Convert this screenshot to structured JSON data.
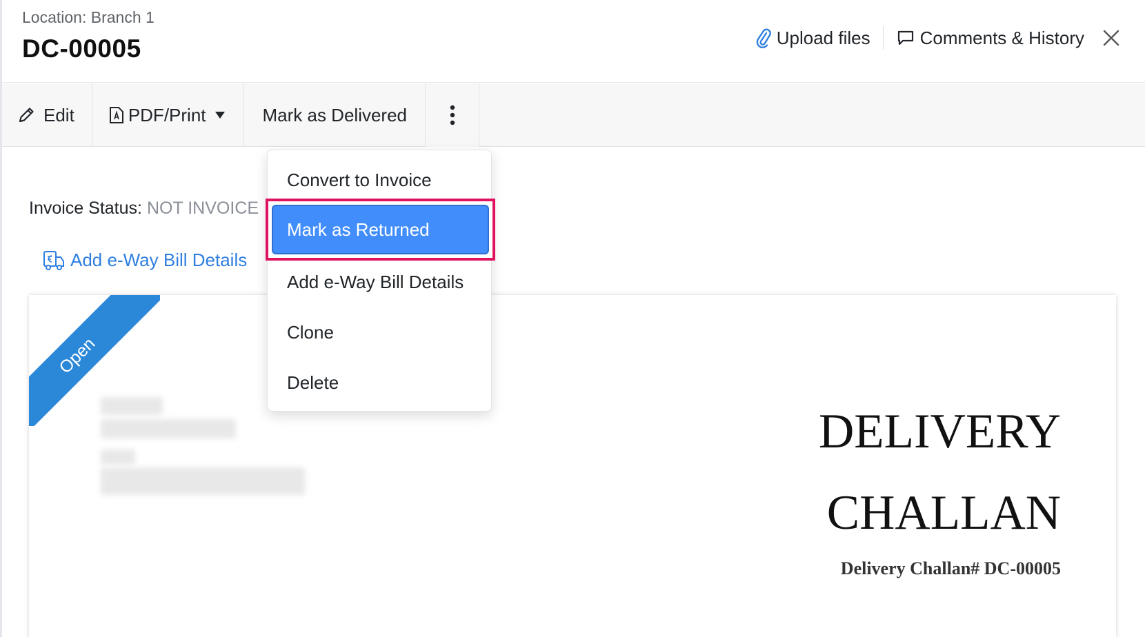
{
  "header": {
    "location": "Location: Branch 1",
    "doc_number": "DC-00005",
    "upload_label": "Upload files",
    "comments_label": "Comments & History"
  },
  "toolbar": {
    "edit_label": "Edit",
    "pdf_label": "PDF/Print",
    "mark_delivered_label": "Mark as Delivered"
  },
  "content": {
    "invoice_status_label": "Invoice Status:",
    "invoice_status_value": "NOT INVOICE",
    "eway_link_label": "Add e-Way Bill Details"
  },
  "dropdown": {
    "items": [
      {
        "label": "Convert to Invoice"
      },
      {
        "label": "Mark as Returned",
        "active": true
      },
      {
        "label": "Add e-Way Bill Details"
      },
      {
        "label": "Clone"
      },
      {
        "label": "Delete"
      }
    ]
  },
  "document": {
    "ribbon": "Open",
    "title_line1": "DELIVERY",
    "title_line2": "CHALLAN",
    "subtitle": "Delivery Challan# DC-00005"
  },
  "colors": {
    "accent": "#408dfb",
    "link": "#2f7fe0",
    "highlight": "#e0115f",
    "ribbon": "#2b88d8"
  },
  "icons": [
    "paperclip-icon",
    "comment-icon",
    "close-icon",
    "pencil-icon",
    "pdf-icon",
    "caret-down-icon",
    "more-vertical-icon",
    "eway-truck-icon"
  ]
}
